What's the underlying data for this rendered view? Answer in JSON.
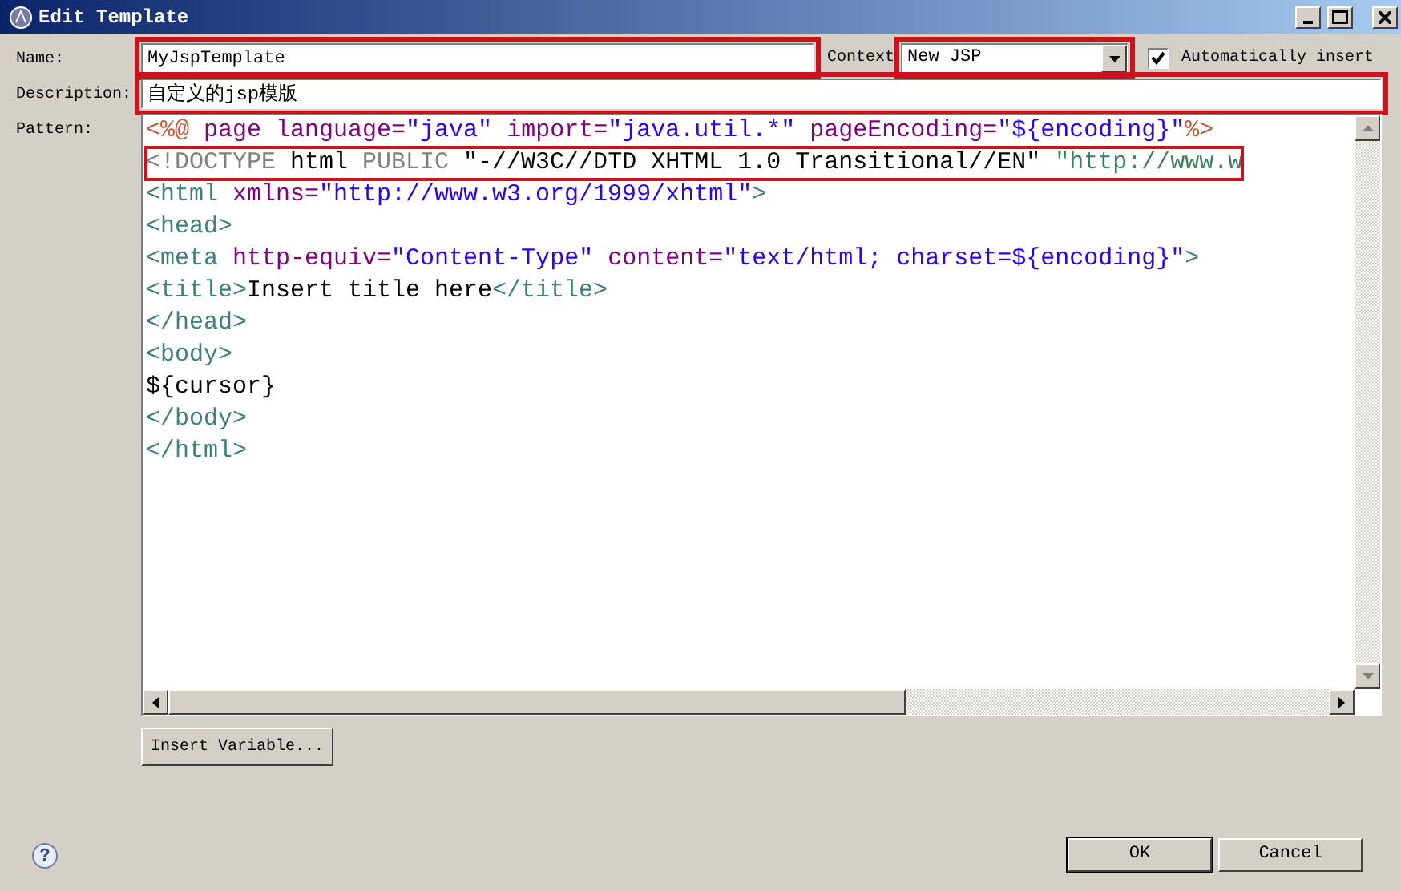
{
  "window": {
    "title": "Edit Template"
  },
  "name_field": {
    "label": "Name:",
    "value": "MyJspTemplate",
    "highlighted": true
  },
  "context": {
    "label": "Context",
    "value": "New JSP",
    "highlighted": true
  },
  "auto_insert": {
    "label": "Automatically insert",
    "checked": true
  },
  "description_field": {
    "label": "Description:",
    "value": "自定义的jsp模版",
    "highlighted": true
  },
  "pattern": {
    "label": "Pattern:",
    "lines": [
      {
        "highlighted": false,
        "segments": [
          {
            "kind": "delim",
            "text": "<%@"
          },
          {
            "kind": "attr",
            "text": " page language="
          },
          {
            "kind": "value",
            "text": "\"java\""
          },
          {
            "kind": "attr",
            "text": " import="
          },
          {
            "kind": "value",
            "text": "\"java.util.*\""
          },
          {
            "kind": "attr",
            "text": " pageEncoding="
          },
          {
            "kind": "value",
            "text": "\"${encoding}\""
          },
          {
            "kind": "delim",
            "text": "%>"
          }
        ]
      },
      {
        "highlighted": true,
        "segments": [
          {
            "kind": "doctype",
            "text": "<!DOCTYPE"
          },
          {
            "kind": "plain",
            "text": " html "
          },
          {
            "kind": "doctype",
            "text": "PUBLIC"
          },
          {
            "kind": "plain",
            "text": " \"-//W3C//DTD XHTML 1.0 Transitional//EN\""
          },
          {
            "kind": "uri",
            "text": " \"http://www.w"
          }
        ]
      },
      {
        "highlighted": false,
        "segments": [
          {
            "kind": "tag",
            "text": "<html"
          },
          {
            "kind": "attr",
            "text": " xmlns="
          },
          {
            "kind": "value",
            "text": "\"http://www.w3.org/1999/xhtml\""
          },
          {
            "kind": "tag",
            "text": ">"
          }
        ]
      },
      {
        "highlighted": false,
        "segments": [
          {
            "kind": "tag",
            "text": "<head>"
          }
        ]
      },
      {
        "highlighted": false,
        "segments": [
          {
            "kind": "tag",
            "text": "<meta"
          },
          {
            "kind": "attr",
            "text": " http-equiv="
          },
          {
            "kind": "value",
            "text": "\"Content-Type\""
          },
          {
            "kind": "attr",
            "text": " content="
          },
          {
            "kind": "value",
            "text": "\"text/html; charset=${encoding}\""
          },
          {
            "kind": "tag",
            "text": ">"
          }
        ]
      },
      {
        "highlighted": false,
        "segments": [
          {
            "kind": "tag",
            "text": "<title>"
          },
          {
            "kind": "plain",
            "text": "Insert title here"
          },
          {
            "kind": "tag",
            "text": "</title>"
          }
        ]
      },
      {
        "highlighted": false,
        "segments": [
          {
            "kind": "tag",
            "text": "</head>"
          }
        ]
      },
      {
        "highlighted": false,
        "segments": [
          {
            "kind": "tag",
            "text": "<body>"
          }
        ]
      },
      {
        "highlighted": false,
        "segments": [
          {
            "kind": "plain",
            "text": "${cursor}"
          }
        ]
      },
      {
        "highlighted": false,
        "segments": [
          {
            "kind": "tag",
            "text": "</body>"
          }
        ]
      },
      {
        "highlighted": false,
        "segments": [
          {
            "kind": "tag",
            "text": "</html>"
          }
        ]
      }
    ]
  },
  "insert_variable_button": "Insert Variable...",
  "help": "?",
  "buttons": [
    {
      "label": "OK"
    },
    {
      "label": "Cancel"
    }
  ]
}
